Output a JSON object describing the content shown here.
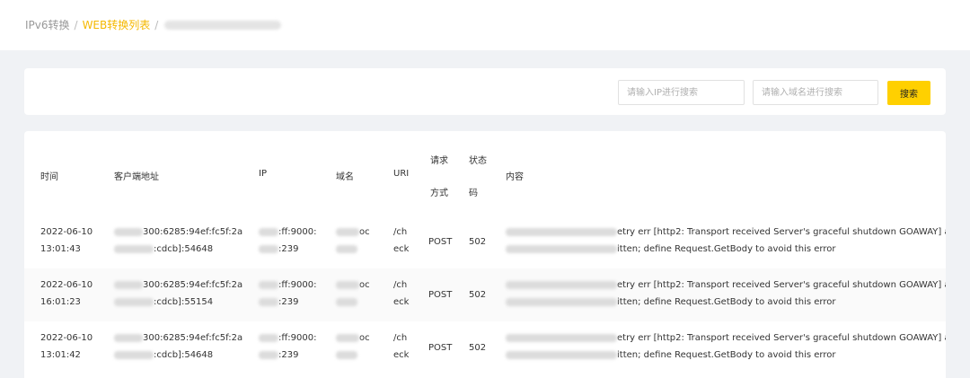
{
  "breadcrumb": {
    "item1": "IPv6转换",
    "sep": "/",
    "item2": "WEB转换列表"
  },
  "search": {
    "ip_placeholder": "请输入IP进行搜索",
    "domain_placeholder": "请输入域名进行搜索",
    "button_label": "搜索"
  },
  "table": {
    "headers": {
      "time": "时间",
      "client": "客户端地址",
      "ip": "IP",
      "domain": "域名",
      "uri": "URI",
      "method_line1": "请求",
      "method_line2": "方式",
      "status_line1": "状态",
      "status_line2": "码",
      "content": "内容"
    },
    "rows": [
      {
        "date": "2022-06-10",
        "time": "13:01:43",
        "client_line1": "300:6285:94ef:fc5f:2a",
        "client_line2": ":cdcb]:54648",
        "ip_line1": ":ff:9000:",
        "ip_line2": ":239",
        "domain_line1": "oc",
        "uri_line1": "/ch",
        "uri_line2": "eck",
        "method": "POST",
        "status": "502",
        "content_line1": "etry err [http2: Transport received Server's graceful shutdown GOAWAY] a",
        "content_line2": "itten; define Request.GetBody to avoid this error"
      },
      {
        "date": "2022-06-10",
        "time": "16:01:23",
        "client_line1": "300:6285:94ef:fc5f:2a",
        "client_line2": ":cdcb]:55154",
        "ip_line1": ":ff:9000:",
        "ip_line2": ":239",
        "domain_line1": "oc",
        "uri_line1": "/ch",
        "uri_line2": "eck",
        "method": "POST",
        "status": "502",
        "content_line1": "etry err [http2: Transport received Server's graceful shutdown GOAWAY] a",
        "content_line2": "itten; define Request.GetBody to avoid this error"
      },
      {
        "date": "2022-06-10",
        "time": "13:01:42",
        "client_line1": "300:6285:94ef:fc5f:2a",
        "client_line2": ":cdcb]:54648",
        "ip_line1": ":ff:9000:",
        "ip_line2": ":239",
        "domain_line1": "oc",
        "uri_line1": "/ch",
        "uri_line2": "eck",
        "method": "POST",
        "status": "502",
        "content_line1": "etry err [http2: Transport received Server's graceful shutdown GOAWAY] a",
        "content_line2": "itten; define Request.GetBody to avoid this error"
      }
    ]
  },
  "colors": {
    "accent": "#ffd000",
    "breadcrumb_active": "#f5b800",
    "page_bg": "#f0f2f5"
  }
}
